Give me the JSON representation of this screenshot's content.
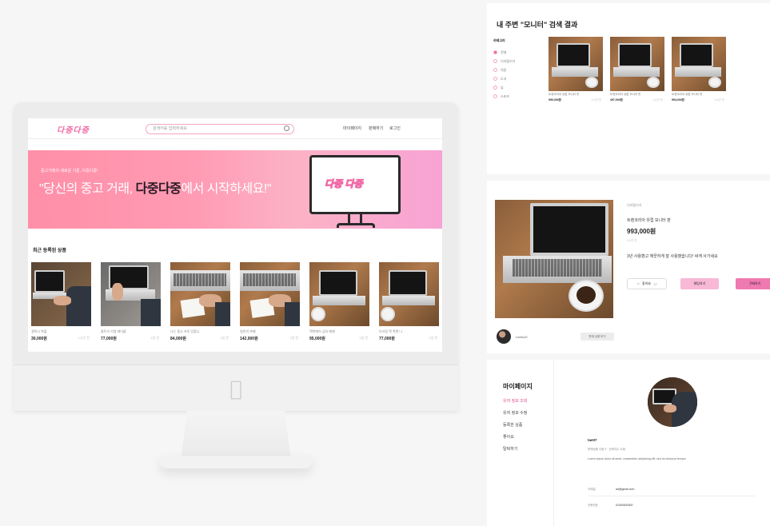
{
  "site": {
    "logo": "다중다중",
    "search_placeholder": "검색어를 입력하세요",
    "nav": [
      "마이페이지",
      "판매하기",
      "로그인"
    ]
  },
  "banner": {
    "subtitle": "중고거래의 새로운 기준, 다중다중!",
    "title_before": "\"당신의 중고 거래, ",
    "title_brand": "다중다중",
    "title_after": "에서 시작하세요!\"",
    "monitor_logo": "다중 다중"
  },
  "recent": {
    "title": "최근 등록된 상품",
    "products": [
      {
        "name": "갤럭시 북플",
        "price": "30,000원",
        "time": "1시간 전"
      },
      {
        "name": "울트라 가볍 테더블",
        "price": "77,000원",
        "time": "1일 전"
      },
      {
        "name": "나는 중고 프로 입합니",
        "price": "84,000원",
        "time": "1일 전"
      },
      {
        "name": "일반의 까페",
        "price": "142,000원",
        "time": "1일 전"
      },
      {
        "name": "맥북에어 급처 매매",
        "price": "95,000원",
        "time": "1일 전"
      },
      {
        "name": "다라링 맥 북렌 나",
        "price": "77,000원",
        "time": "1일 전"
      }
    ]
  },
  "search_panel": {
    "title": "내 주변 \"모니터\" 검색 결과",
    "category_head": "카테고리",
    "categories": [
      "전체",
      "디지털기기",
      "의류",
      "도서",
      "뷰",
      "스포츠"
    ],
    "results": [
      {
        "name": "트렌코리아 유럽 모니터 판",
        "price": "990,000원",
        "time": "1시간 전"
      },
      {
        "name": "트렌코리아 유럽 모니터 판",
        "price": "497,000원",
        "time": "1시간 전"
      },
      {
        "name": "트렌코리아 유럽 모니터 판",
        "price": "994,000원",
        "time": "1시간 전"
      }
    ]
  },
  "detail_panel": {
    "category": "디지털기기",
    "title": "트렌코리아 유럽 모니터 판",
    "price": "993,000원",
    "time": "1시간 전",
    "description": "3년 사용했고 깨끗하게 잘 사용했습니다! 싸게 사가세요",
    "like_label": "좋아요",
    "like_count": "12",
    "chat_label": "채팅하기",
    "buy_label": "구매하기",
    "seller": "Leetu10",
    "more_label": "판매 상품 보기"
  },
  "mypage_panel": {
    "title": "마이페이지",
    "menu": [
      "유저 정보 조회",
      "유저 정보 수정",
      "등록한 상품",
      "좋아요",
      "탈퇴하기"
    ],
    "name": "tae07",
    "meta": "판매상품 수량 3 · 신뢰지수 11점",
    "bio": "Lorem ipsum dolor sit amet, consectetur adipiscing elit, sed do eiusmod tempor",
    "fields": [
      {
        "label": "이메일",
        "value": "ad@gmail.com"
      },
      {
        "label": "전화번호",
        "value": "01000000000"
      }
    ]
  }
}
